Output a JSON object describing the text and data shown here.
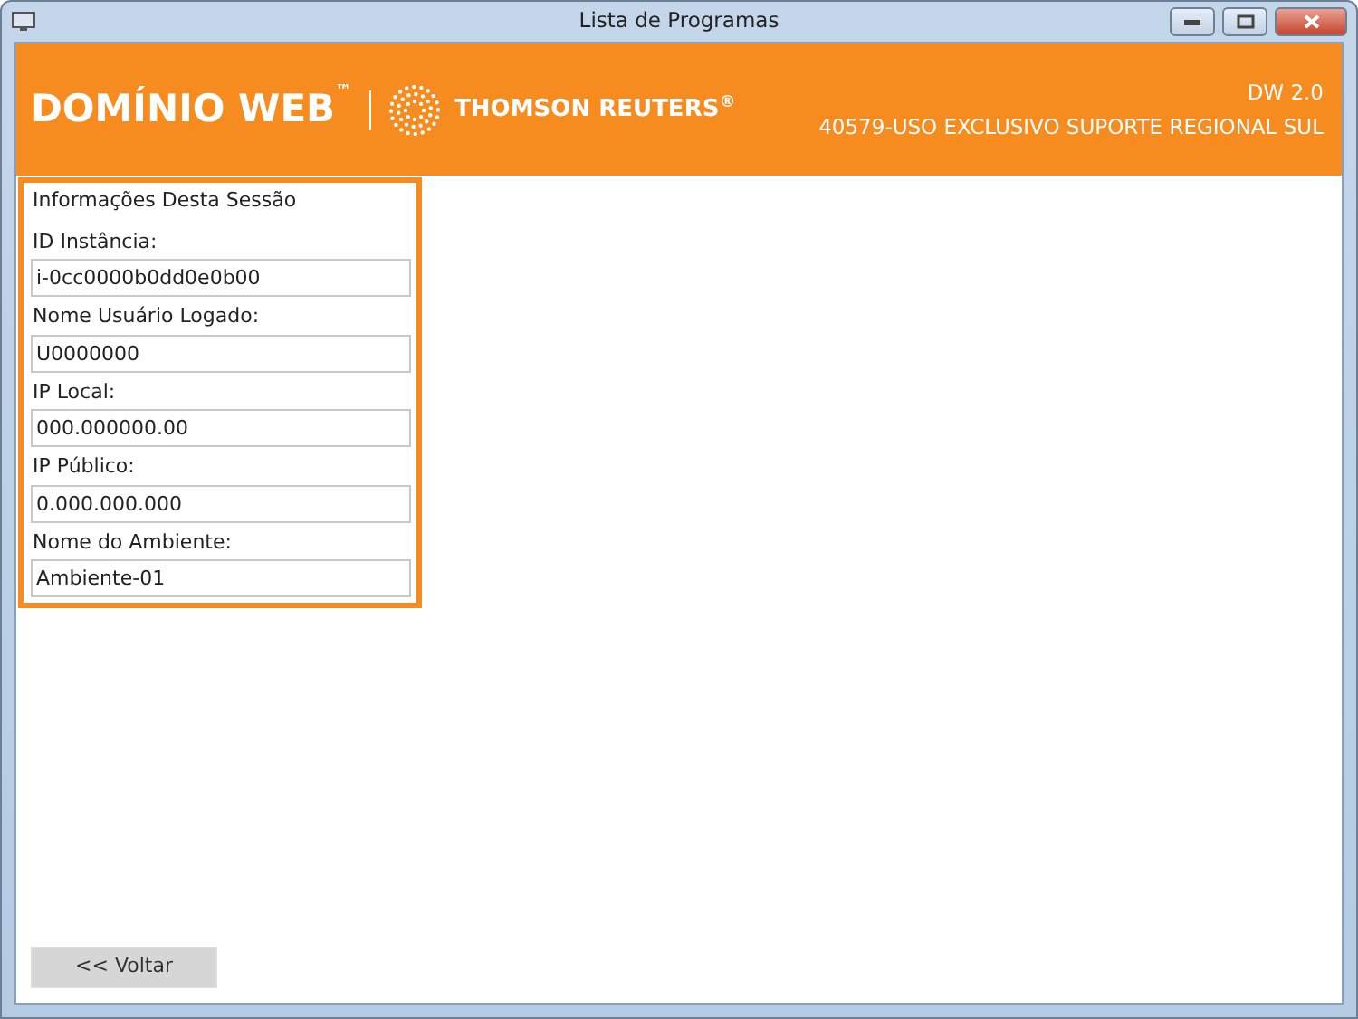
{
  "window": {
    "title": "Lista de Programas"
  },
  "header": {
    "brand": "DOMÍNIO WEB",
    "trademark": "™",
    "partner": "THOMSON REUTERS",
    "partner_mark": "®",
    "version": "DW 2.0",
    "license": "40579-USO EXCLUSIVO SUPORTE REGIONAL SUL"
  },
  "session": {
    "title": "Informações Desta Sessão",
    "fields": [
      {
        "label": "ID Instância:",
        "value": "i-0cc0000b0dd0e0b00"
      },
      {
        "label": "Nome Usuário Logado:",
        "value": "U0000000"
      },
      {
        "label": "IP Local:",
        "value": "000.000000.00"
      },
      {
        "label": "IP Público:",
        "value": "0.000.000.000"
      },
      {
        "label": "Nome do Ambiente:",
        "value": "Ambiente-01"
      }
    ]
  },
  "buttons": [
    "<< Voltar"
  ]
}
